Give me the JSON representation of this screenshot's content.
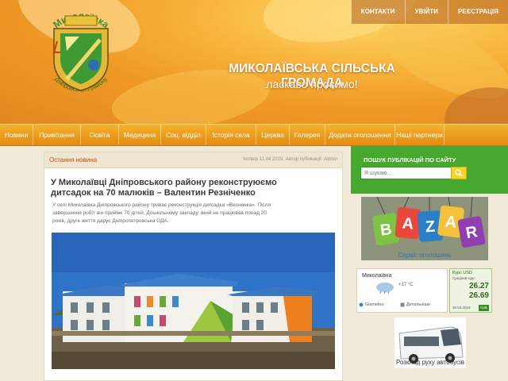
{
  "top_links": [
    "КОНТАКТИ",
    "УВІЙТИ",
    "РЕЄСТРАЦІЯ"
  ],
  "emblem": {
    "text": "Миколаївка",
    "subtext": "Дніпровського району"
  },
  "site": {
    "title": "МИКОЛАЇВСЬКА СІЛЬСЬКА ГРОМАДА",
    "subtitle": "ласкаво просимо!"
  },
  "nav": [
    "Новини",
    "Привітання",
    "Освіта",
    "Медицина",
    "Соц. відділ",
    "Історія села",
    "Церква",
    "Галерея",
    "Додати оголошення",
    "Наші партнери"
  ],
  "article": {
    "section_label": "Остання новина",
    "meta": "Четвер 11.04.2019, Автор публікації: Admin",
    "title": "У Миколаївці Дніпровського району реконструюємо дитсадок на 70 малюків – Валентин Резніченко",
    "excerpt": "У селі Миколаївка Дніпровського району триває реконструкція дитсадка «Веснянка». Після завершення робіт він прийме 70 дітей. Дошкільному закладу, який не працював понад 20 років, друге життя дарує Дніпропетровська ОДА."
  },
  "search": {
    "title": "ПОШУК ПУБЛІКАЦІЙ ПО САЙТУ",
    "placeholder": "Я шукаю..."
  },
  "bazar": {
    "letters": [
      "B",
      "A",
      "Z",
      "A",
      "R"
    ],
    "caption": "Сервіс оголошень"
  },
  "weather": {
    "city": "Миколаївка",
    "temp": "+17 °C",
    "link1": "Gismeteo",
    "link2": "Детальніше"
  },
  "currency": {
    "title": "Курс USD",
    "subtitle": "Средний курс",
    "value1": "26.27",
    "value2": "26.69",
    "date": "30.04.2019",
    "logo": "i.ua"
  },
  "bus": {
    "caption": "Розклад руху автобусів"
  },
  "colors": {
    "accent": "#47a830",
    "nav": "#f0a020",
    "link": "#c84c0c"
  }
}
